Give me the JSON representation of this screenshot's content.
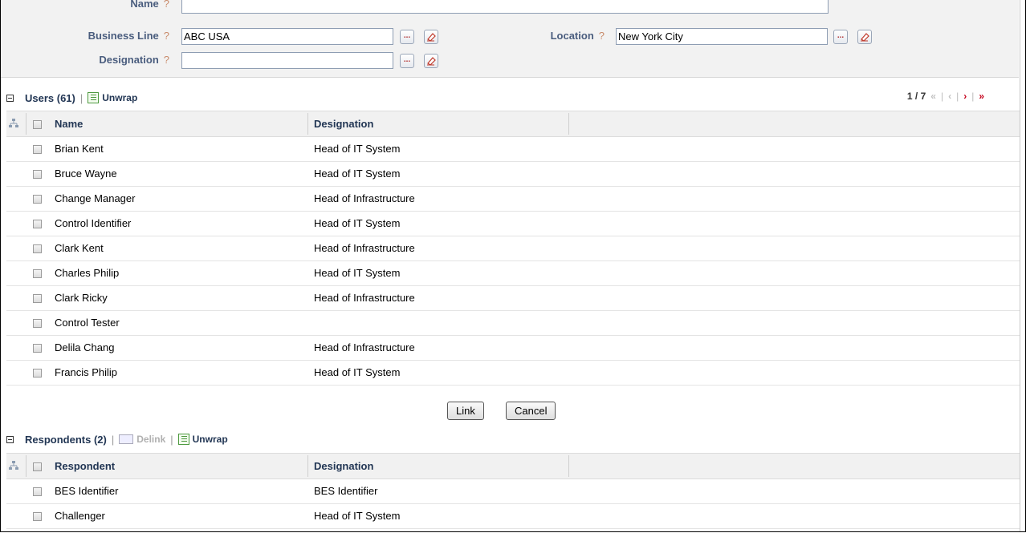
{
  "filters": {
    "name": {
      "label": "Name",
      "value": ""
    },
    "business_line": {
      "label": "Business Line",
      "value": "ABC USA"
    },
    "location": {
      "label": "Location",
      "value": "New York City"
    },
    "designation": {
      "label": "Designation",
      "value": ""
    },
    "help_mark": "?",
    "lookup_label": "..."
  },
  "users": {
    "title": "Users (61)",
    "unwrap_label": "Unwrap",
    "pager": {
      "text": "1 / 7",
      "first": "«",
      "prev": "‹",
      "next": "›",
      "last": "»"
    },
    "columns": [
      "Name",
      "Designation"
    ],
    "rows": [
      {
        "name": "Brian Kent",
        "designation": "Head of IT System"
      },
      {
        "name": "Bruce Wayne",
        "designation": "Head of IT System"
      },
      {
        "name": "Change Manager",
        "designation": "Head of Infrastructure"
      },
      {
        "name": "Control Identifier",
        "designation": "Head of IT System"
      },
      {
        "name": "Clark Kent",
        "designation": "Head of Infrastructure"
      },
      {
        "name": "Charles Philip",
        "designation": "Head of IT System"
      },
      {
        "name": "Clark Ricky",
        "designation": "Head of Infrastructure"
      },
      {
        "name": "Control Tester",
        "designation": ""
      },
      {
        "name": "Delila Chang",
        "designation": "Head of Infrastructure"
      },
      {
        "name": "Francis Philip",
        "designation": "Head of IT System"
      }
    ]
  },
  "buttons": {
    "link": "Link",
    "cancel": "Cancel"
  },
  "respondents": {
    "title": "Respondents (2)",
    "delink_label": "Delink",
    "unwrap_label": "Unwrap",
    "columns": [
      "Respondent",
      "Designation"
    ],
    "rows": [
      {
        "name": "BES Identifier",
        "designation": "BES Identifier"
      },
      {
        "name": "Challenger",
        "designation": "Head of IT System"
      }
    ]
  },
  "colors": {
    "accent": "#c4001a",
    "header_text": "#223654",
    "label_text": "#4a5d7e"
  }
}
